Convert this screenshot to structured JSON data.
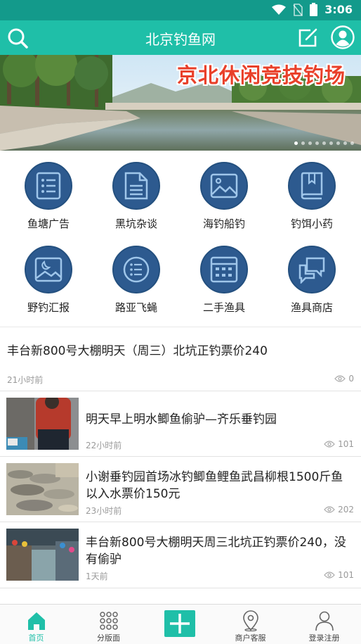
{
  "status_bar": {
    "time": "3:06"
  },
  "header": {
    "title": "北京钓鱼网"
  },
  "banner": {
    "overlay_title": "京北休闲竞技钓场",
    "slide_count": 9,
    "active_slide": 1
  },
  "categories": [
    {
      "label": "鱼塘广告",
      "icon": "list-icon"
    },
    {
      "label": "黑坑杂谈",
      "icon": "document-icon"
    },
    {
      "label": "海钓船钓",
      "icon": "landscape-image-icon"
    },
    {
      "label": "钓饵小药",
      "icon": "book-icon"
    },
    {
      "label": "野钓汇报",
      "icon": "night-image-icon"
    },
    {
      "label": "路亚飞蝇",
      "icon": "bulleted-list-icon"
    },
    {
      "label": "二手渔具",
      "icon": "calendar-grid-icon"
    },
    {
      "label": "渔具商店",
      "icon": "chat-bubbles-icon"
    }
  ],
  "news": [
    {
      "title": "丰台新800号大棚明天（周三）北坑正钓票价240",
      "time": "21小时前",
      "views": "0"
    },
    {
      "title": "明天早上明水鲫鱼偷驴—齐乐垂钓园",
      "time": "22小时前",
      "views": "101"
    },
    {
      "title": "小谢垂钓园首场冰钓鲫鱼鲤鱼武昌柳根1500斤鱼以入水票价150元",
      "time": "23小时前",
      "views": "202"
    },
    {
      "title": "丰台新800号大棚明天周三北坑正钓票价240，没有偷驴",
      "time": "1天前",
      "views": "101"
    }
  ],
  "tabs": [
    {
      "label": "首页",
      "icon": "home-icon",
      "active": true
    },
    {
      "label": "分版面",
      "icon": "dots-grid-icon",
      "active": false
    },
    {
      "label": "",
      "icon": "plus-icon",
      "active": false
    },
    {
      "label": "商户客服",
      "icon": "location-pin-icon",
      "active": false
    },
    {
      "label": "登录注册",
      "icon": "person-icon",
      "active": false
    }
  ],
  "colors": {
    "primary": "#1fbfa8",
    "status_bar": "#139a8b",
    "category_circle": "#2d5a8f",
    "banner_title": "#e9402a"
  }
}
